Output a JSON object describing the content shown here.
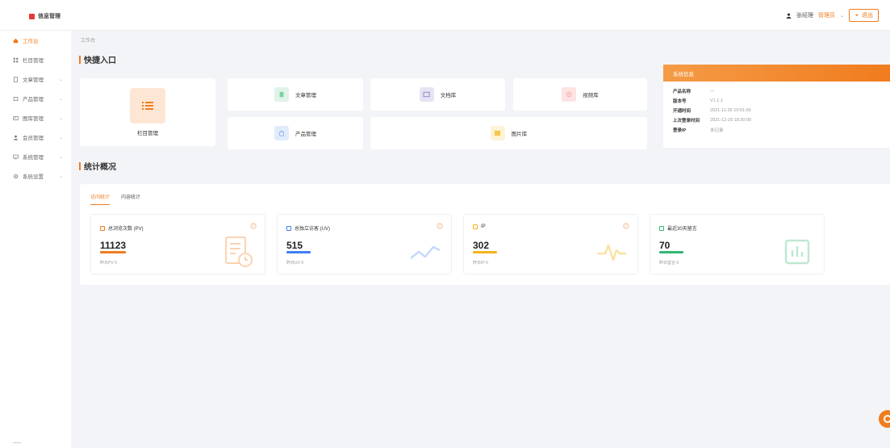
{
  "app": {
    "title": "信息管理"
  },
  "header": {
    "user_name": "张经理",
    "user_role": "管理员",
    "exit_label": "退出"
  },
  "sidebar": {
    "items": [
      {
        "label": "工作台",
        "active": true,
        "has_arrow": false
      },
      {
        "label": "栏目管理",
        "active": false,
        "has_arrow": false
      },
      {
        "label": "文章管理",
        "active": false,
        "has_arrow": true
      },
      {
        "label": "产品管理",
        "active": false,
        "has_arrow": true
      },
      {
        "label": "图库管理",
        "active": false,
        "has_arrow": true
      },
      {
        "label": "会员管理",
        "active": false,
        "has_arrow": true
      },
      {
        "label": "系统管理",
        "active": false,
        "has_arrow": true
      },
      {
        "label": "系统设置",
        "active": false,
        "has_arrow": true
      }
    ]
  },
  "breadcrumb": "工作台",
  "quick_entry": {
    "title": "快捷入口",
    "big_item": {
      "label": "栏目管理"
    },
    "items": [
      {
        "label": "文章管理"
      },
      {
        "label": "文档库"
      },
      {
        "label": "视频库"
      },
      {
        "label": "产品管理"
      },
      {
        "label": "图片库"
      }
    ]
  },
  "system_info": {
    "title": "系统信息",
    "rows": [
      {
        "key": "产品名称",
        "value": "—"
      },
      {
        "key": "版本号",
        "value": "V1.1.1"
      },
      {
        "key": "开通时间",
        "value": "2021-11-26 10:01:56"
      },
      {
        "key": "上次登录时间",
        "value": "2021-12-29 18:30:00"
      },
      {
        "key": "登录IP",
        "value": "未记录"
      }
    ]
  },
  "stats": {
    "title": "统计概况",
    "tabs": [
      {
        "label": "访问统计"
      },
      {
        "label": "内容统计"
      }
    ],
    "cards": [
      {
        "label": "总浏览次数 (PV)",
        "value": "11123",
        "sub": "昨日PV 0",
        "color": "#f07c1e"
      },
      {
        "label": "总独立访客 (UV)",
        "value": "515",
        "sub": "昨日UV 0",
        "color": "#3f7ef2"
      },
      {
        "label": "IP",
        "value": "302",
        "sub": "昨日IP 0",
        "color": "#f5b31d"
      },
      {
        "label": "最近30天留言",
        "value": "70",
        "sub": "昨日留言 0",
        "color": "#2fb872"
      }
    ]
  },
  "colors": {
    "accent": "#f07c1e",
    "blue": "#3f7ef2",
    "yellow": "#f5b31d",
    "green": "#2fb872"
  }
}
